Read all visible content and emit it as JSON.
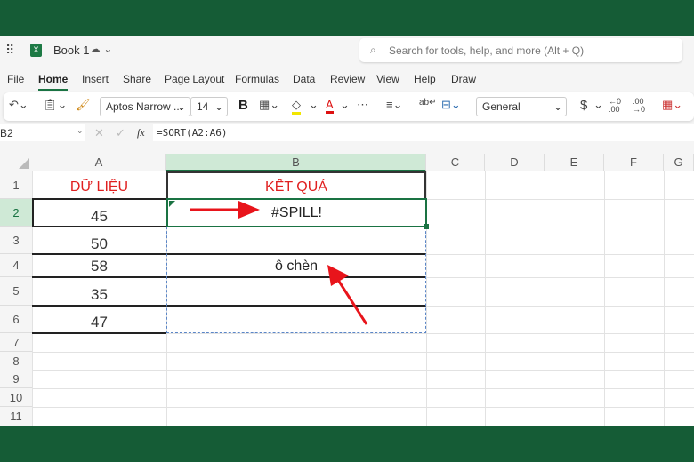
{
  "app": {
    "title": "Book 1",
    "search_placeholder": "Search for tools, help, and more (Alt + Q)"
  },
  "tabs": [
    {
      "label": "File"
    },
    {
      "label": "Home",
      "active": true
    },
    {
      "label": "Insert"
    },
    {
      "label": "Share"
    },
    {
      "label": "Page Layout"
    },
    {
      "label": "Formulas"
    },
    {
      "label": "Data"
    },
    {
      "label": "Review"
    },
    {
      "label": "View"
    },
    {
      "label": "Help"
    },
    {
      "label": "Draw"
    }
  ],
  "ribbon": {
    "font_name": "Aptos Narrow ...",
    "font_size": "14",
    "bold": "B",
    "number_format": "General",
    "currency": "$",
    "more": "⋯"
  },
  "formula_bar": {
    "name_box": "B2",
    "fx": "fx",
    "formula": "=SORT(A2:A6)"
  },
  "columns": [
    "A",
    "B",
    "C",
    "D",
    "E",
    "F",
    "G"
  ],
  "rows": [
    "1",
    "2",
    "3",
    "4",
    "5",
    "6",
    "7",
    "8",
    "9",
    "10",
    "11"
  ],
  "cells": {
    "A1": "DỮ LIỆU",
    "B1": "KẾT QUẢ",
    "A2": "45",
    "A3": "50",
    "A4": "58",
    "A5": "35",
    "A6": "47",
    "B2": "#SPILL!",
    "B4": "ô chèn"
  },
  "colors": {
    "brand": "#155c36",
    "header_red": "#e02020",
    "arrow": "#e8141b",
    "selection": "#1a7343",
    "spill_border": "#5b86c7"
  }
}
